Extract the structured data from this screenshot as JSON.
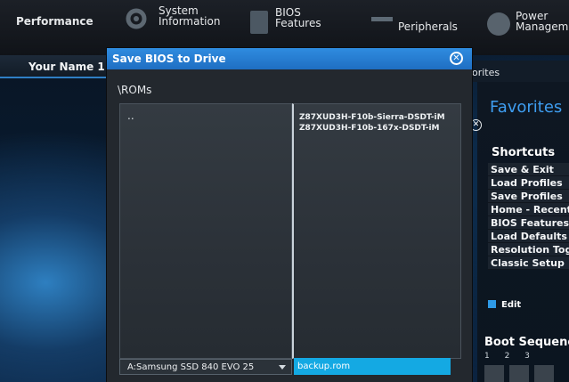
{
  "topnav": {
    "items": [
      {
        "label": "Performance",
        "icon": "performance-icon"
      },
      {
        "label": "System\nInformation",
        "icon": "system-information-icon"
      },
      {
        "label": "BIOS\nFeatures",
        "icon": "bios-chip-icon"
      },
      {
        "label": "Peripherals",
        "icon": "peripherals-icon"
      },
      {
        "label": "Power\nManageme",
        "icon": "power-icon"
      }
    ]
  },
  "profile": {
    "name": "Your Name 1"
  },
  "favorites": {
    "tab_label": "orites",
    "title": "Favorites",
    "shortcuts_title": "Shortcuts",
    "shortcuts": [
      "Save & Exit",
      "Load Profiles",
      "Save Profiles",
      "Home - Recent",
      "BIOS Features",
      "Load Defaults",
      "Resolution Tog",
      "Classic Setup"
    ],
    "edit_label": "Edit",
    "boot_title": "Boot Sequenc",
    "boot_numbers": "1 2 3"
  },
  "dialog": {
    "title": "Save BIOS to Drive",
    "path": "\\ROMs",
    "parent_dir": "..",
    "files": [
      "Z87XUD3H-F10b-Sierra-DSDT-iM",
      "Z87XUD3H-F10b-167x-DSDT-iM"
    ],
    "drive": "A:Samsung SSD 840 EVO 25",
    "filename": "backup.rom"
  },
  "colors": {
    "accent": "#2f8ce0",
    "input_fill": "#14a9e3",
    "favorites_title": "#3e9df0"
  }
}
